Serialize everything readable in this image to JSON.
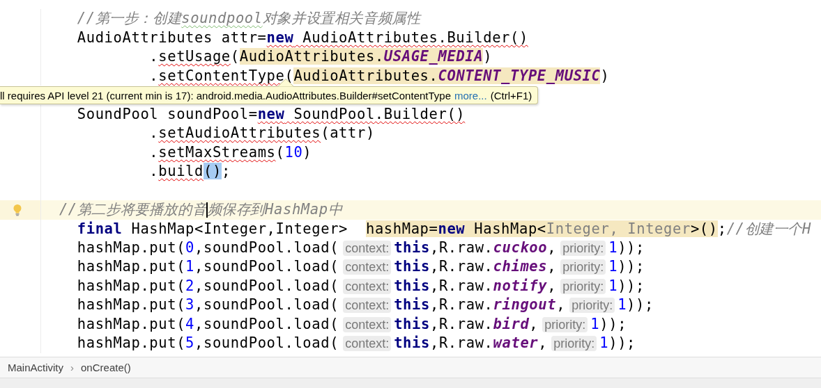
{
  "editor": {
    "lines": [
      {
        "kind": "code",
        "current": false,
        "bulb": false,
        "tokens": [
          {
            "text": "    //第一步：创建",
            "kind": "comment"
          },
          {
            "text": "soundpool",
            "kind": "comment",
            "typo": true
          },
          {
            "text": "对象并设置相关音频属性",
            "kind": "comment"
          }
        ]
      },
      {
        "kind": "code",
        "current": false,
        "bulb": false,
        "tokens": [
          {
            "text": "    AudioAttributes attr=",
            "kind": "plain"
          },
          {
            "text": "new",
            "kind": "keyword",
            "error": true
          },
          {
            "text": " AudioAttributes.Builder()",
            "kind": "plain",
            "error": true
          }
        ]
      },
      {
        "kind": "code",
        "current": false,
        "bulb": false,
        "tokens": [
          {
            "text": "            .",
            "kind": "plain"
          },
          {
            "text": "setUsage",
            "kind": "plain",
            "error": true
          },
          {
            "text": "(",
            "kind": "plain"
          },
          {
            "text": "AudioAttributes.",
            "kind": "plain",
            "highlighted": true
          },
          {
            "text": "USAGE_MEDIA",
            "kind": "constant",
            "highlighted": true
          },
          {
            "text": ")",
            "kind": "plain"
          }
        ]
      },
      {
        "kind": "code",
        "current": false,
        "bulb": false,
        "tokens": [
          {
            "text": "            .",
            "kind": "plain"
          },
          {
            "text": "setContentType",
            "kind": "plain",
            "error": true
          },
          {
            "text": "(",
            "kind": "plain"
          },
          {
            "text": "AudioAttributes.",
            "kind": "plain",
            "highlighted": true
          },
          {
            "text": "CONTENT_TYPE_MUSIC",
            "kind": "constant",
            "highlighted": true
          },
          {
            "text": ")",
            "kind": "plain"
          }
        ]
      },
      {
        "kind": "covered"
      },
      {
        "kind": "code",
        "current": false,
        "bulb": false,
        "tokens": [
          {
            "text": "    SoundPool soundPool=",
            "kind": "plain"
          },
          {
            "text": "new",
            "kind": "keyword",
            "error": true
          },
          {
            "text": " SoundPool.Builder()",
            "kind": "plain",
            "error": true
          }
        ]
      },
      {
        "kind": "code",
        "current": false,
        "bulb": false,
        "tokens": [
          {
            "text": "            .",
            "kind": "plain"
          },
          {
            "text": "setAudioAttributes",
            "kind": "plain",
            "error": true
          },
          {
            "text": "(attr)",
            "kind": "plain"
          }
        ]
      },
      {
        "kind": "code",
        "current": false,
        "bulb": false,
        "tokens": [
          {
            "text": "            .",
            "kind": "plain"
          },
          {
            "text": "setMaxStreams",
            "kind": "plain",
            "error": true
          },
          {
            "text": "(",
            "kind": "plain"
          },
          {
            "text": "10",
            "kind": "number"
          },
          {
            "text": ")",
            "kind": "plain"
          }
        ]
      },
      {
        "kind": "code",
        "current": false,
        "bulb": false,
        "tokens": [
          {
            "text": "            .",
            "kind": "plain"
          },
          {
            "text": "build",
            "kind": "plain",
            "error": true
          },
          {
            "text": "()",
            "kind": "plain",
            "selected": true
          },
          {
            "text": ";",
            "kind": "plain"
          }
        ]
      },
      {
        "kind": "code",
        "current": false,
        "bulb": false
      },
      {
        "kind": "code",
        "current": true,
        "bulb": true,
        "tokens": [
          {
            "text": "  //第二步将要播放的音",
            "kind": "comment",
            "caret": true
          },
          {
            "text": "频保存到HashMap中",
            "kind": "comment"
          }
        ]
      },
      {
        "kind": "code",
        "current": false,
        "bulb": false,
        "tokens": [
          {
            "text": "    final",
            "kind": "keyword"
          },
          {
            "text": " HashMap<Integer,Integer>  ",
            "kind": "plain"
          },
          {
            "text": "hashMap=",
            "kind": "plain",
            "highlighted": true
          },
          {
            "text": "new",
            "kind": "keyword",
            "highlighted": true
          },
          {
            "text": " HashMap<",
            "kind": "plain",
            "highlighted": true
          },
          {
            "text": "Integer, Integer",
            "kind": "grey",
            "highlighted": true
          },
          {
            "text": ">()",
            "kind": "plain",
            "highlighted": true
          },
          {
            "text": ";",
            "kind": "plain"
          },
          {
            "text": "//创建一个H",
            "kind": "comment"
          }
        ]
      },
      {
        "kind": "code",
        "current": false,
        "bulb": false,
        "tokens": [
          {
            "text": "    hashMap.put(",
            "kind": "plain"
          },
          {
            "text": "0",
            "kind": "number"
          },
          {
            "text": ",soundPool.load(",
            "kind": "plain"
          },
          {
            "text": "context:",
            "kind": "hint"
          },
          {
            "text": "this",
            "kind": "keyword"
          },
          {
            "text": ",R.raw.",
            "kind": "plain"
          },
          {
            "text": "cuckoo",
            "kind": "constant"
          },
          {
            "text": ",",
            "kind": "plain"
          },
          {
            "text": "priority:",
            "kind": "hint"
          },
          {
            "text": "1",
            "kind": "number"
          },
          {
            "text": "));",
            "kind": "plain"
          }
        ]
      },
      {
        "kind": "code",
        "current": false,
        "bulb": false,
        "tokens": [
          {
            "text": "    hashMap.put(",
            "kind": "plain"
          },
          {
            "text": "1",
            "kind": "number"
          },
          {
            "text": ",soundPool.load(",
            "kind": "plain"
          },
          {
            "text": "context:",
            "kind": "hint"
          },
          {
            "text": "this",
            "kind": "keyword"
          },
          {
            "text": ",R.raw.",
            "kind": "plain"
          },
          {
            "text": "chimes",
            "kind": "constant"
          },
          {
            "text": ",",
            "kind": "plain"
          },
          {
            "text": "priority:",
            "kind": "hint"
          },
          {
            "text": "1",
            "kind": "number"
          },
          {
            "text": "));",
            "kind": "plain"
          }
        ]
      },
      {
        "kind": "code",
        "current": false,
        "bulb": false,
        "tokens": [
          {
            "text": "    hashMap.put(",
            "kind": "plain"
          },
          {
            "text": "2",
            "kind": "number"
          },
          {
            "text": ",soundPool.load(",
            "kind": "plain"
          },
          {
            "text": "context:",
            "kind": "hint"
          },
          {
            "text": "this",
            "kind": "keyword"
          },
          {
            "text": ",R.raw.",
            "kind": "plain"
          },
          {
            "text": "notify",
            "kind": "constant"
          },
          {
            "text": ",",
            "kind": "plain"
          },
          {
            "text": "priority:",
            "kind": "hint"
          },
          {
            "text": "1",
            "kind": "number"
          },
          {
            "text": "));",
            "kind": "plain"
          }
        ]
      },
      {
        "kind": "code",
        "current": false,
        "bulb": false,
        "tokens": [
          {
            "text": "    hashMap.put(",
            "kind": "plain"
          },
          {
            "text": "3",
            "kind": "number"
          },
          {
            "text": ",soundPool.load(",
            "kind": "plain"
          },
          {
            "text": "context:",
            "kind": "hint"
          },
          {
            "text": "this",
            "kind": "keyword"
          },
          {
            "text": ",R.raw.",
            "kind": "plain"
          },
          {
            "text": "ringout",
            "kind": "constant"
          },
          {
            "text": ",",
            "kind": "plain"
          },
          {
            "text": "priority:",
            "kind": "hint"
          },
          {
            "text": "1",
            "kind": "number"
          },
          {
            "text": "));",
            "kind": "plain"
          }
        ]
      },
      {
        "kind": "code",
        "current": false,
        "bulb": false,
        "tokens": [
          {
            "text": "    hashMap.put(",
            "kind": "plain"
          },
          {
            "text": "4",
            "kind": "number"
          },
          {
            "text": ",soundPool.load(",
            "kind": "plain"
          },
          {
            "text": "context:",
            "kind": "hint"
          },
          {
            "text": "this",
            "kind": "keyword"
          },
          {
            "text": ",R.raw.",
            "kind": "plain"
          },
          {
            "text": "bird",
            "kind": "constant"
          },
          {
            "text": ",",
            "kind": "plain"
          },
          {
            "text": "priority:",
            "kind": "hint"
          },
          {
            "text": "1",
            "kind": "number"
          },
          {
            "text": "));",
            "kind": "plain"
          }
        ]
      },
      {
        "kind": "code",
        "current": false,
        "bulb": false,
        "tokens": [
          {
            "text": "    hashMap.put(",
            "kind": "plain"
          },
          {
            "text": "5",
            "kind": "number"
          },
          {
            "text": ",soundPool.load(",
            "kind": "plain"
          },
          {
            "text": "context:",
            "kind": "hint"
          },
          {
            "text": "this",
            "kind": "keyword"
          },
          {
            "text": ",R.raw.",
            "kind": "plain"
          },
          {
            "text": "water",
            "kind": "constant"
          },
          {
            "text": ",",
            "kind": "plain"
          },
          {
            "text": "priority:",
            "kind": "hint"
          },
          {
            "text": "1",
            "kind": "number"
          },
          {
            "text": "));",
            "kind": "plain"
          }
        ]
      }
    ]
  },
  "tooltip": {
    "message": "ll requires API level 21 (current min is 17): android.media.AudioAttributes.Builder#setContentType",
    "link": "more...",
    "shortcut": "(Ctrl+F1)"
  },
  "breadcrumbs": {
    "items": [
      {
        "label": "MainActivity"
      },
      {
        "label": "onCreate()"
      }
    ],
    "separator": "›"
  }
}
